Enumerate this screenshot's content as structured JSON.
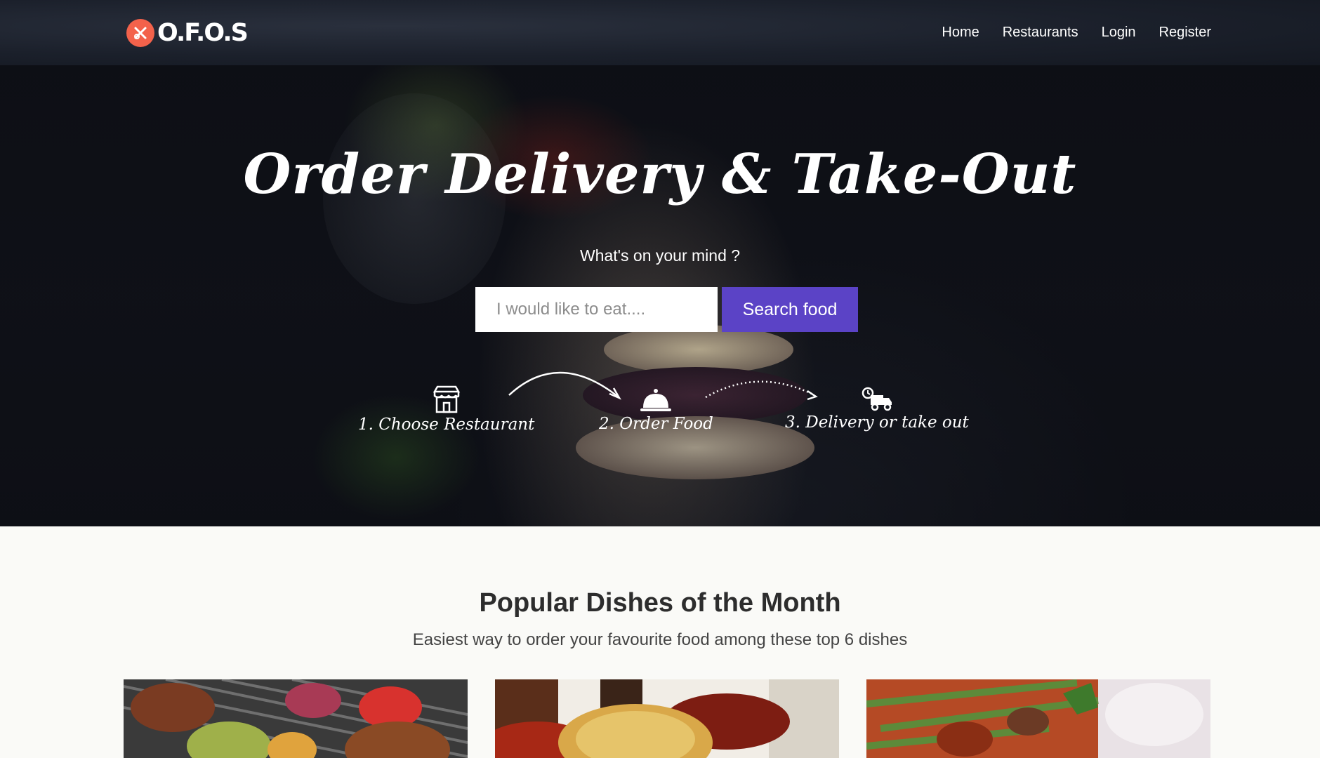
{
  "brand": {
    "name": "O.F.O.S",
    "accent": "#f3624b"
  },
  "nav": {
    "items": [
      "Home",
      "Restaurants",
      "Login",
      "Register"
    ]
  },
  "hero": {
    "title": "Order Delivery & Take-Out",
    "subtitle": "What's on your mind ?",
    "search": {
      "placeholder": "I would like to eat....",
      "button_label": "Search food",
      "button_color": "#5b43c6"
    },
    "steps": [
      {
        "label": "1. Choose Restaurant",
        "icon": "storefront-icon"
      },
      {
        "label": "2. Order Food",
        "icon": "cloche-icon"
      },
      {
        "label": "3. Delivery or take out",
        "icon": "delivery-truck-icon"
      }
    ]
  },
  "popular": {
    "title": "Popular Dishes of the Month",
    "subtitle": "Easiest way to order your favourite food among these top 6 dishes"
  }
}
